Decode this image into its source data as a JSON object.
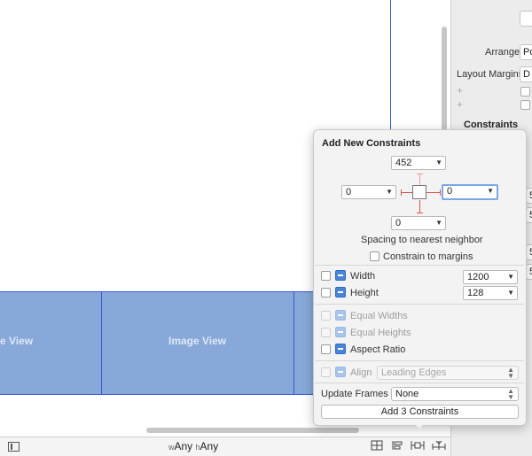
{
  "canvas": {
    "image_view_label": "Image View",
    "image_view_label_partial": "e View"
  },
  "bottom_bar": {
    "width_prefix": "w",
    "width_value": "Any",
    "height_prefix": "h",
    "height_value": "Any"
  },
  "inspector": {
    "arrange_label": "Arrange",
    "arrange_value": "Po",
    "layout_margins_label": "Layout Margins",
    "layout_margins_value": "D",
    "constraints_title": "Constraints",
    "plus": "+",
    "field_values": [
      "5",
      "5",
      "5",
      "5"
    ]
  },
  "popover": {
    "title": "Add New Constraints",
    "top_value": "452",
    "left_value": "0",
    "right_value": "0",
    "bottom_value": "0",
    "spacing_caption": "Spacing to nearest neighbor",
    "constrain_margins_label": "Constrain to margins",
    "width_label": "Width",
    "width_value": "1200",
    "height_label": "Height",
    "height_value": "128",
    "equal_widths_label": "Equal Widths",
    "equal_heights_label": "Equal Heights",
    "aspect_ratio_label": "Aspect Ratio",
    "align_label": "Align",
    "align_value": "Leading Edges",
    "update_frames_label": "Update Frames",
    "update_frames_value": "None",
    "add_button_label": "Add 3 Constraints"
  },
  "colors": {
    "accent": "#3a56d6",
    "image_fill": "#87a8d9",
    "constraint_red": "#d9534f",
    "focus_ring": "#7aa7e8"
  }
}
